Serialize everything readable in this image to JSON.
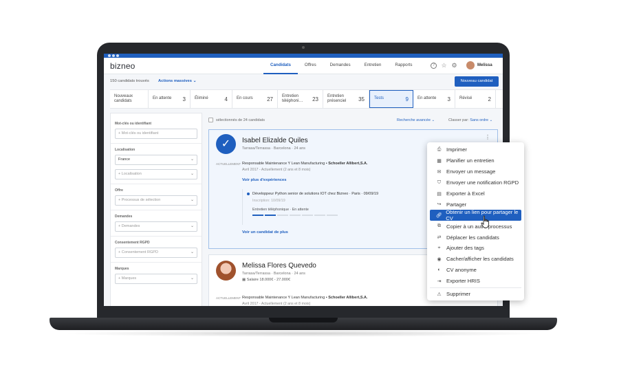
{
  "app": {
    "logo": "bizneo",
    "nav": [
      "Candidats",
      "Offres",
      "Demandes",
      "Entretien",
      "Rapports"
    ],
    "user_name": "Melissa"
  },
  "toolbar": {
    "count": "150 candidats trouvés",
    "mass_actions": "Actions massives ⌄",
    "new_button": "Nouveau candidat"
  },
  "stages": [
    {
      "label": "Nouveaux candidats",
      "count": ""
    },
    {
      "label": "En attente",
      "count": "3"
    },
    {
      "label": "Éliminé",
      "count": "4"
    },
    {
      "label": "En cours",
      "count": "27"
    },
    {
      "label": "Entretien téléphoni…",
      "count": "23"
    },
    {
      "label": "Entretien présenciel",
      "count": "35"
    },
    {
      "label": "Tests",
      "count": "9"
    },
    {
      "label": "En attente",
      "count": "3"
    },
    {
      "label": "Révisé",
      "count": "2"
    }
  ],
  "filters": {
    "keywords_label": "Mot-clés ou identifiant",
    "keywords_placeholder": "+ Mot-clés ou identifiant",
    "location_label": "Localisation",
    "location_value": "France",
    "location_placeholder": "+ Localisation",
    "offer_label": "Offre",
    "offer_placeholder": "+ Processus de sélection",
    "requests_label": "Demandes",
    "requests_placeholder": "+ Demandes",
    "gdpr_label": "Consentement RGPD",
    "gdpr_placeholder": "+ Consentement RGPD",
    "brands_label": "Marques",
    "brands_placeholder": "+ Marques"
  },
  "results": {
    "selected_text": "sélectionnés de 24 candidats",
    "advanced_search": "Recherche avancée ⌄",
    "sort_label": "Classer par:",
    "sort_value": "Sans ordre ⌄"
  },
  "candidates": [
    {
      "name": "Isabel Elizalde Quiles",
      "location": "Tarrasa/Terrassa · Barcelona · 24 ans",
      "now_tag": "ACTUELLEMENT",
      "job": "Responsable Maintenance Y Lean Manufacturing  •  ",
      "company": "Schoeller Allibert,S.A.",
      "job_period": "Avril 2017 - Actuellement (2 ans et 8 mois)",
      "experiences_link": "Voir plus d'expériences",
      "process_title": "Développeur Python senior de solutions IOT chez Bizneo  ·  Paris  · 09/09/19",
      "process_date": "Inscription: 10/09/19",
      "process_stage": "Entretien téléphonique · En attente",
      "view_link": "Voir un candidat de plus"
    },
    {
      "name": "Melissa Flores Quevedo",
      "location": "Tarrasa/Terrassa · Barcelona · 24 ans",
      "salary": "Salaire 18.000€ - 27.000€",
      "now_tag": "ACTUELLEMENT",
      "job": "Responsable Maintenance Y Lean Manufacturing  •  ",
      "company": "Schoeller Allibert,S.A.",
      "job_period": "Avril 2017 - Actuellement (2 ans et 8 mois)"
    }
  ],
  "menu": [
    {
      "label": "Imprimer",
      "icon": "printer-icon"
    },
    {
      "label": "Planifier un entretien",
      "icon": "calendar-icon"
    },
    {
      "label": "Envoyer un message",
      "icon": "envelope-icon"
    },
    {
      "label": "Envoyer une notification RGPD",
      "icon": "shield-icon"
    },
    {
      "label": "Exporter à Excel",
      "icon": "excel-icon"
    },
    {
      "label": "Partager",
      "icon": "share-icon"
    },
    {
      "label": "Obtenir un lien pour partager le CV",
      "icon": "link-icon"
    },
    {
      "label": "Copier à un autre processus",
      "icon": "copy-icon"
    },
    {
      "label": "Déplacer les candidats",
      "icon": "move-icon"
    },
    {
      "label": "Ajouter des tags",
      "icon": "tag-icon"
    },
    {
      "label": "Cacher/afficher les candidats",
      "icon": "eye-icon"
    },
    {
      "label": "CV anonyme",
      "icon": "anonymous-icon"
    },
    {
      "label": "Exporter HRIS",
      "icon": "export-icon"
    },
    {
      "label": "Supprimer",
      "icon": "warning-icon"
    }
  ],
  "colors": {
    "accent": "#1f5fbf",
    "menu_highlight": "#1f5fbf"
  }
}
